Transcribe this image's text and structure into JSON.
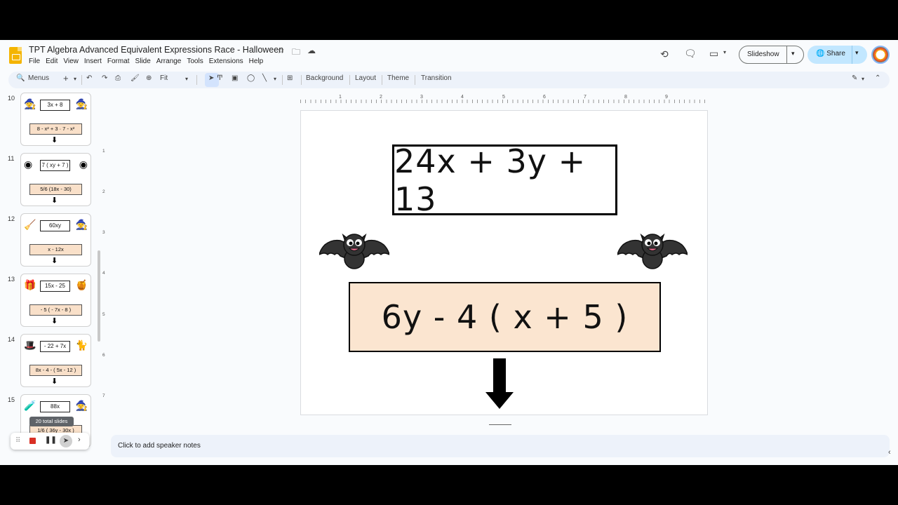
{
  "app": {
    "title": "TPT Algebra Advanced Equivalent Expressions Race - Halloween",
    "menu": [
      "File",
      "Edit",
      "View",
      "Insert",
      "Format",
      "Slide",
      "Arrange",
      "Tools",
      "Extensions",
      "Help"
    ],
    "slideshow_label": "Slideshow",
    "share_label": "Share"
  },
  "toolbar": {
    "menus_label": "Menus",
    "zoom_label": "Fit",
    "background_label": "Background",
    "layout_label": "Layout",
    "theme_label": "Theme",
    "transition_label": "Transition"
  },
  "ruler": {
    "h": [
      "1",
      "2",
      "3",
      "4",
      "5",
      "6",
      "7",
      "8",
      "9"
    ],
    "v": [
      "1",
      "2",
      "3",
      "4",
      "5",
      "6",
      "7"
    ]
  },
  "filmstrip": {
    "slides": [
      {
        "num": "10",
        "top": "3x + 8",
        "bottom": "8 - x² + 3 · 7 - x²",
        "icon_left": "🧙",
        "icon_right": "🧙"
      },
      {
        "num": "11",
        "top": "7 ( xy + 7 )",
        "bottom": "5/6 (18x - 30)",
        "icon_left": "◉",
        "icon_right": "◉"
      },
      {
        "num": "12",
        "top": "60xy",
        "bottom": "x - 12x",
        "icon_left": "🧹",
        "icon_right": "🧙"
      },
      {
        "num": "13",
        "top": "15x - 25",
        "bottom": "- 5 ( - 7x - 8 )",
        "icon_left": "🎁",
        "icon_right": "🍯"
      },
      {
        "num": "14",
        "top": "- 22 + 7x",
        "bottom": "8x - 4 - ( 5x - 12 )",
        "icon_left": "🎩",
        "icon_right": "🐈"
      },
      {
        "num": "15",
        "top": "88x",
        "bottom": "1/6 ( 36y - 30x )",
        "icon_left": "🧪",
        "icon_right": "🧙"
      }
    ],
    "tooltip": "20 total slides"
  },
  "slide": {
    "top_expression": "24x + 3y + 13",
    "bottom_expression": "6y - 4 ( x + 5 )"
  },
  "notes": {
    "placeholder": "Click to add speaker notes"
  },
  "colors": {
    "accent": "#c2e7ff",
    "answer_box": "#fbe5d0",
    "recording": "#d93025"
  }
}
